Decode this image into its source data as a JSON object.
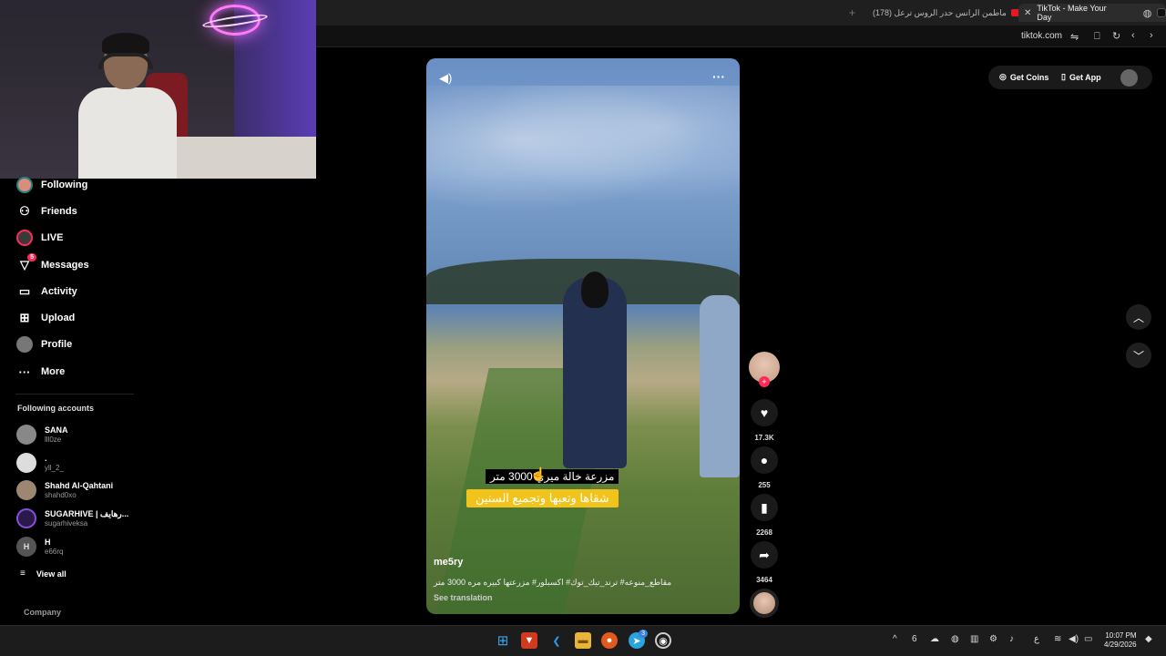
{
  "browser": {
    "tabs": [
      {
        "label": "(178) ماطمن الرانس حدر الروس ترعل"
      },
      {
        "label": "TikTok - Make Your Day"
      }
    ],
    "url": "tiktok.com"
  },
  "sidebar": {
    "items": [
      {
        "label": "Following"
      },
      {
        "label": "Friends"
      },
      {
        "label": "LIVE"
      },
      {
        "label": "Messages",
        "badge": "5"
      },
      {
        "label": "Activity"
      },
      {
        "label": "Upload"
      },
      {
        "label": "Profile"
      },
      {
        "label": "More"
      }
    ],
    "following_title": "Following accounts",
    "accounts": [
      {
        "name": "SANA",
        "handle": "lll0ze"
      },
      {
        "name": ".",
        "handle": "yll_2_"
      },
      {
        "name": "Shahd Al-Qahtani",
        "handle": "shahd0xo"
      },
      {
        "name": "SUGARHIVE | رهايف...",
        "handle": "sugarhiveksa"
      },
      {
        "name": "H",
        "handle": "e66rq",
        "initial": "H"
      }
    ],
    "view_all": "View all",
    "company": "Company"
  },
  "video": {
    "caption_line1": "مزرعة خالة ميري 3000 متر",
    "caption_line2": "شقاها وتعبها وتجميع السنين",
    "username": "me5ry",
    "description": "مقاطع_منوعه# ترند_تيك_توك# اكسبلور# مزرعتها كبيره مره 3000 متر",
    "see_translation": "See translation"
  },
  "actions": {
    "likes": "17.3K",
    "comments": "255",
    "saves": "2268",
    "shares": "3464"
  },
  "header": {
    "get_coins": "Get Coins",
    "get_app": "Get App"
  },
  "taskbar": {
    "time": "10:07 PM",
    "date": "4/29/2026",
    "lang": "ع",
    "telegram_badge": "3"
  },
  "colors": {
    "accent": "#fe2c55",
    "caption_bg": "#f2c41b"
  }
}
